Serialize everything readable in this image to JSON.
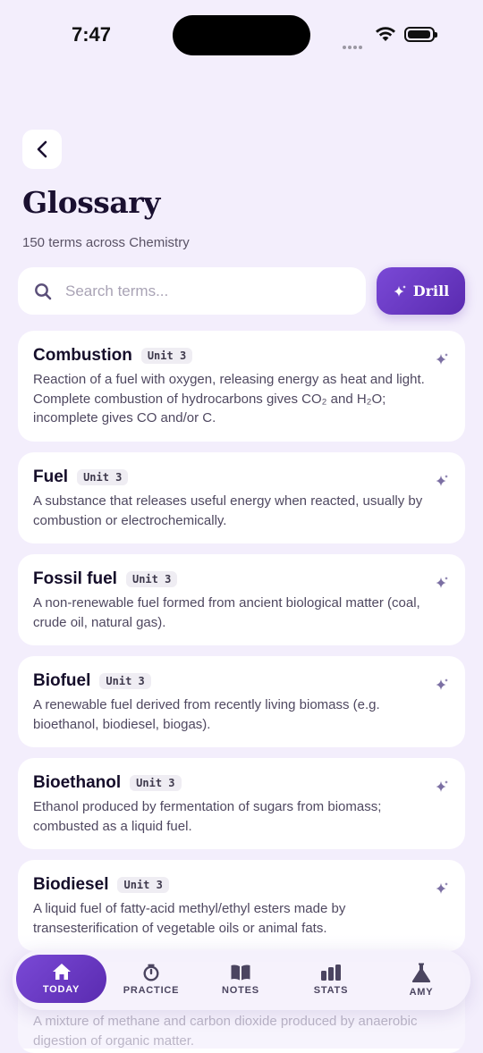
{
  "status_bar": {
    "time": "7:47"
  },
  "header": {
    "title": "Glossary",
    "subtitle": "150 terms across Chemistry"
  },
  "search": {
    "placeholder": "Search terms..."
  },
  "drill_label": "Drill",
  "terms": [
    {
      "term": "Combustion",
      "unit": "Unit 3",
      "definition": "Reaction of a fuel with oxygen, releasing energy as heat and light. Complete combustion of hydrocarbons gives CO₂ and H₂O; incomplete gives CO and/or C."
    },
    {
      "term": "Fuel",
      "unit": "Unit 3",
      "definition": "A substance that releases useful energy when reacted, usually by combustion or electrochemically."
    },
    {
      "term": "Fossil fuel",
      "unit": "Unit 3",
      "definition": "A non-renewable fuel formed from ancient biological matter (coal, crude oil, natural gas)."
    },
    {
      "term": "Biofuel",
      "unit": "Unit 3",
      "definition": "A renewable fuel derived from recently living biomass (e.g. bioethanol, biodiesel, biogas)."
    },
    {
      "term": "Bioethanol",
      "unit": "Unit 3",
      "definition": "Ethanol produced by fermentation of sugars from biomass; combusted as a liquid fuel."
    },
    {
      "term": "Biodiesel",
      "unit": "Unit 3",
      "definition": "A liquid fuel of fatty-acid methyl/ethyl esters made by transesterification of vegetable oils or animal fats."
    },
    {
      "term": "",
      "unit": "",
      "definition": "A mixture of methane and carbon dioxide produced by anaerobic digestion of organic matter."
    }
  ],
  "tabs": [
    {
      "label": "TODAY",
      "icon": "home-icon",
      "active": true
    },
    {
      "label": "PRACTICE",
      "icon": "stopwatch-icon",
      "active": false
    },
    {
      "label": "NOTES",
      "icon": "book-icon",
      "active": false
    },
    {
      "label": "STATS",
      "icon": "bar-chart-icon",
      "active": false
    },
    {
      "label": "AMY",
      "icon": "flask-icon",
      "active": false
    }
  ],
  "colors": {
    "accent": "#6a3bc8",
    "background": "#f3eefc"
  }
}
